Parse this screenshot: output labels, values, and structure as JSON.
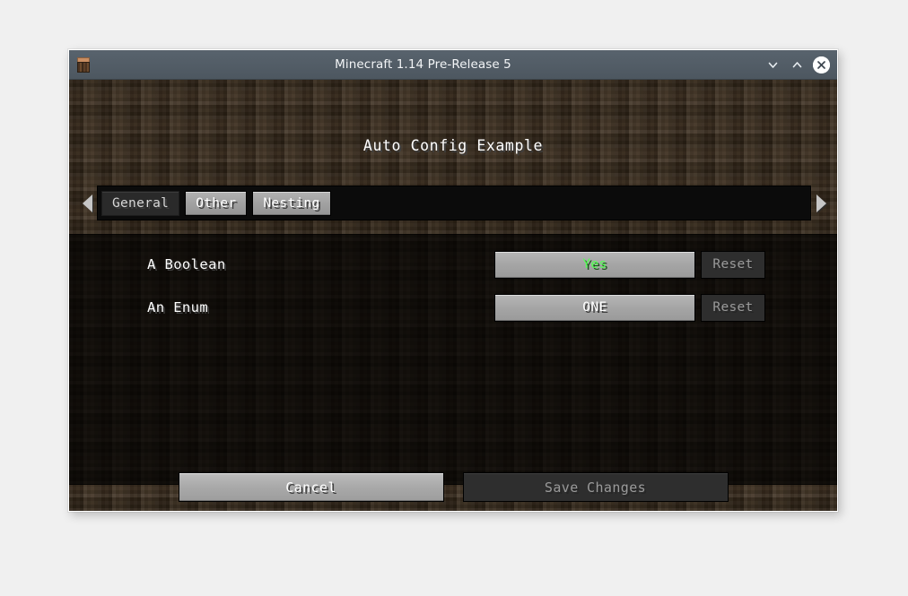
{
  "window": {
    "title": "Minecraft 1.14 Pre-Release 5",
    "app_icon": "minecraft-block-icon",
    "controls": {
      "minimize": "chevron-down-icon",
      "maximize": "chevron-up-icon",
      "close": "close-icon"
    }
  },
  "screen": {
    "title": "Auto Config Example"
  },
  "tabbar": {
    "scroll_left": "arrow-left-icon",
    "scroll_right": "arrow-right-icon",
    "tabs": [
      {
        "label": "General",
        "state": "selected"
      },
      {
        "label": "Other",
        "state": "normal"
      },
      {
        "label": "Nesting",
        "state": "normal"
      }
    ]
  },
  "entries": [
    {
      "label": "A Boolean",
      "value": "Yes",
      "value_color": "#55FF55",
      "reset_label": "Reset",
      "reset_enabled": false
    },
    {
      "label": "An Enum",
      "value": "ONE",
      "value_color": "#FFFFFF",
      "reset_label": "Reset",
      "reset_enabled": false
    }
  ],
  "footer": {
    "cancel_label": "Cancel",
    "save_label": "Save Changes"
  },
  "colors": {
    "desktop_bg": "#F0F0F0",
    "titlebar": "#4E5A64",
    "dirt": "#382A1B",
    "accent_green": "#55FF55"
  }
}
